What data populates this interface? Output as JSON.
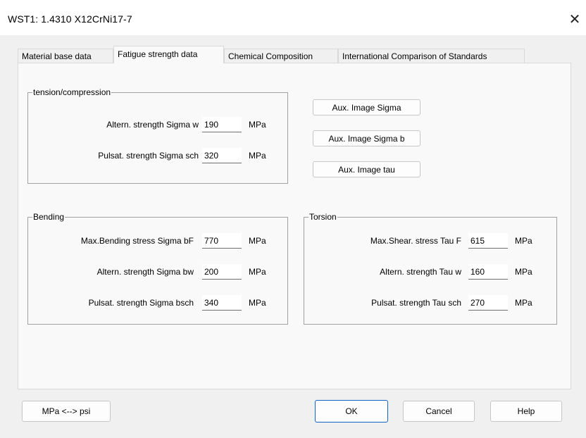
{
  "window": {
    "title": "WST1: 1.4310    X12CrNi17-7",
    "close_glyph": "✕"
  },
  "tabs": [
    {
      "label": "Material base data",
      "active": false
    },
    {
      "label": "Fatigue strength data",
      "active": true
    },
    {
      "label": "Chemical Composition",
      "active": false
    },
    {
      "label": "International Comparison of Standards",
      "active": false
    }
  ],
  "tension": {
    "title": "tension/compression",
    "rows": [
      {
        "label": "Altern. strength  Sigma w",
        "value": "190",
        "unit": "MPa"
      },
      {
        "label": "Pulsat. strength  Sigma sch",
        "value": "320",
        "unit": "MPa"
      }
    ]
  },
  "aux_buttons": [
    "Aux. Image Sigma",
    "Aux. Image Sigma b",
    "Aux. Image tau"
  ],
  "bending": {
    "title": "Bending",
    "rows": [
      {
        "label": "Max.Bending stress  Sigma bF",
        "value": "770",
        "unit": "MPa"
      },
      {
        "label": "Altern. strength  Sigma bw",
        "value": "200",
        "unit": "MPa"
      },
      {
        "label": "Pulsat. strength  Sigma bsch",
        "value": "340",
        "unit": "MPa"
      }
    ]
  },
  "torsion": {
    "title": "Torsion",
    "rows": [
      {
        "label": "Max.Shear. stress  Tau F",
        "value": "615",
        "unit": "MPa"
      },
      {
        "label": "Altern. strength  Tau w",
        "value": "160",
        "unit": "MPa"
      },
      {
        "label": "Pulsat. strength  Tau sch",
        "value": "270",
        "unit": "MPa"
      }
    ]
  },
  "footer": {
    "convert_label": "MPa <--> psi",
    "ok_label": "OK",
    "cancel_label": "Cancel",
    "help_label": "Help"
  }
}
